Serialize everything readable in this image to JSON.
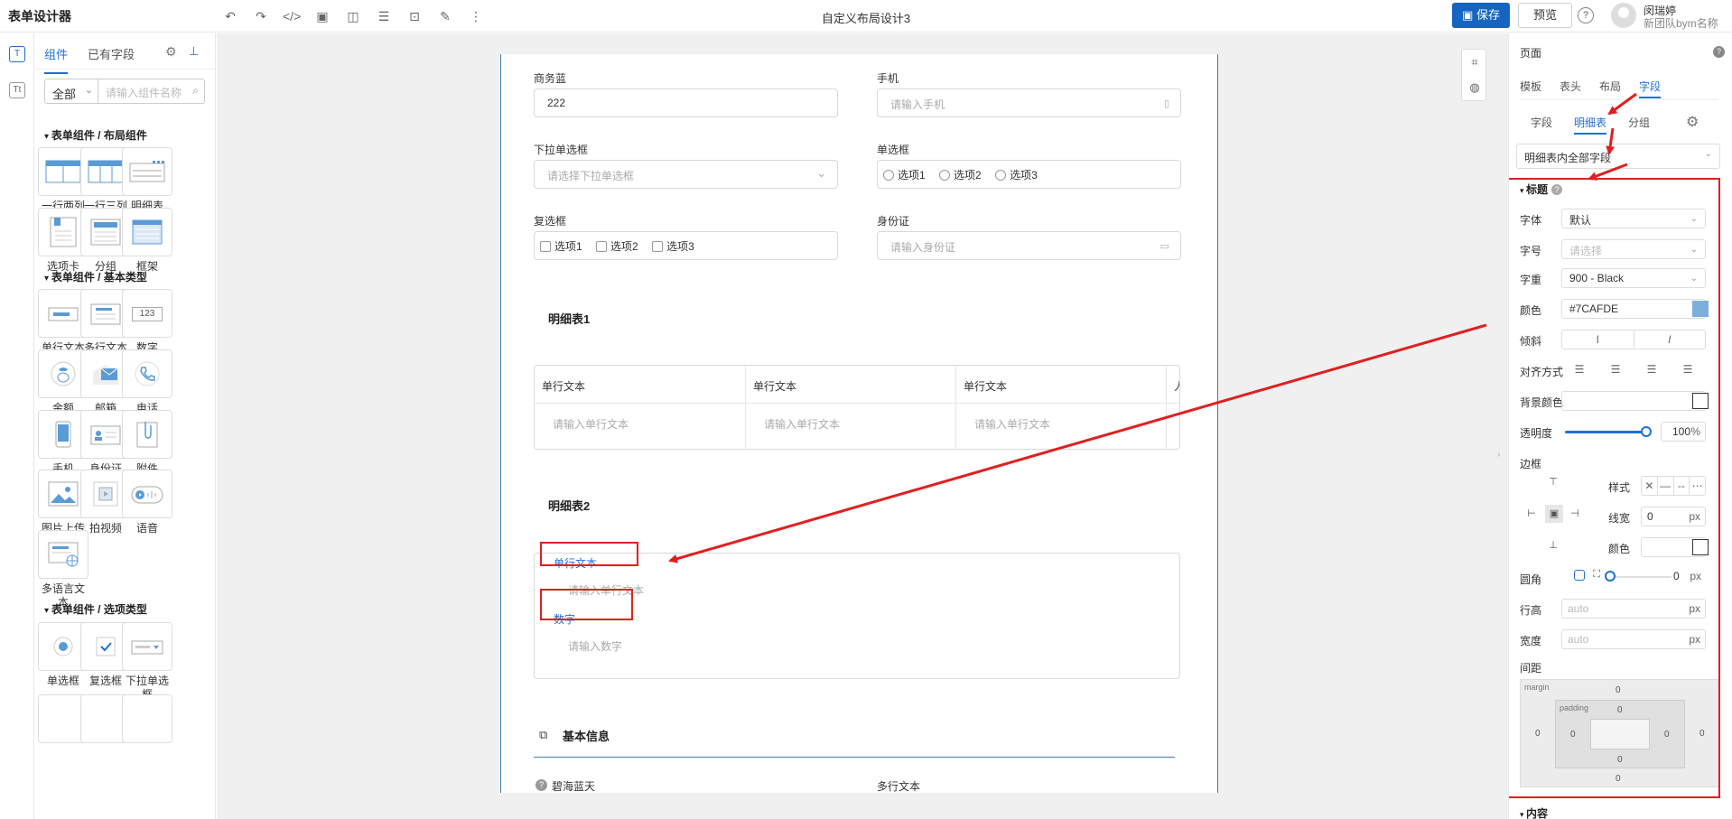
{
  "header": {
    "app_title": "表单设计器",
    "page_title": "自定义布局设计3",
    "save_label": "保存",
    "preview_label": "预览",
    "help_label": "?",
    "user_name": "闵瑞婷",
    "user_team": "新团队bym名称"
  },
  "component_panel": {
    "tabs": [
      "组件",
      "已有字段"
    ],
    "filter_value": "全部",
    "search_placeholder": "请输入组件名称",
    "sections": [
      {
        "title": "表单组件 / 布局组件",
        "items": [
          "一行两列",
          "一行三列",
          "明细表",
          "选项卡",
          "分组",
          "框架"
        ]
      },
      {
        "title": "表单组件 / 基本类型",
        "items": [
          "单行文本",
          "多行文本",
          "数字",
          "金额",
          "邮箱",
          "电话",
          "手机",
          "身份证",
          "附件",
          "图片上传",
          "拍视频",
          "语音",
          "多语言文本"
        ]
      },
      {
        "title": "表单组件 / 选项类型",
        "items": [
          "单选框",
          "复选框",
          "下拉单选框"
        ]
      }
    ],
    "number_icon_text": "123"
  },
  "form": {
    "fields": [
      {
        "label": "商务蓝",
        "value": "222",
        "placeholder": ""
      },
      {
        "label": "手机",
        "value": "",
        "placeholder": "请输入手机"
      },
      {
        "label": "下拉单选框",
        "value": "",
        "placeholder": "请选择下拉单选框"
      },
      {
        "label": "单选框",
        "options": [
          "选项1",
          "选项2",
          "选项3"
        ]
      },
      {
        "label": "复选框",
        "options": [
          "选项1",
          "选项2",
          "选项3"
        ]
      },
      {
        "label": "身份证",
        "value": "",
        "placeholder": "请输入身份证"
      }
    ],
    "detail_table_1": {
      "title": "明细表1",
      "columns": [
        "单行文本",
        "单行文本",
        "单行文本",
        "人"
      ],
      "cell_placeholder": "请输入单行文本"
    },
    "detail_table_2": {
      "title": "明细表2",
      "items": [
        {
          "label": "单行文本",
          "placeholder": "请输入单行文本"
        },
        {
          "label": "数字",
          "placeholder": "请输入数字"
        }
      ]
    },
    "group": {
      "title": "基本信息",
      "field_left": "碧海蓝天",
      "field_right": "多行文本"
    }
  },
  "properties": {
    "header": "页面",
    "help": "?",
    "tabs": [
      "模板",
      "表头",
      "布局",
      "字段"
    ],
    "active_tab": "字段",
    "subtabs": [
      "字段",
      "明细表",
      "分组"
    ],
    "active_subtab": "明细表",
    "scope_select": "明细表内全部字段",
    "title_section": "标题",
    "font_label": "字体",
    "font_value": "默认",
    "size_label": "字号",
    "size_placeholder": "请选择",
    "weight_label": "字重",
    "weight_value": "900 - Black",
    "color_label": "颜色",
    "color_value": "#7CAFDE",
    "italic_label": "倾斜",
    "align_label": "对齐方式",
    "bg_label": "背景颜色",
    "opacity_label": "透明度",
    "opacity_value": "100",
    "opacity_unit": "%",
    "opacity_level": 1.0,
    "border_label": "边框",
    "border_style_label": "样式",
    "border_width_label": "线宽",
    "border_width_value": "0",
    "border_color_label": "颜色",
    "radius_label": "圆角",
    "radius_value": "0",
    "line_height_label": "行高",
    "line_height_placeholder": "auto",
    "width_label": "宽度",
    "width_placeholder": "auto",
    "unit_px": "px",
    "spacing_label": "间距",
    "margin_label": "margin",
    "padding_label": "padding",
    "spacing_values": {
      "m_top": "0",
      "m_bottom": "0",
      "m_left": "0",
      "m_right": "0",
      "p_top": "0",
      "p_bottom": "0",
      "p_left": "0",
      "p_right": "0"
    },
    "content_section": "内容"
  },
  "colors": {
    "accent": "#1e6fd9",
    "save_button": "#1565c0",
    "annotation_red": "#e02020",
    "title_color_swatch": "#7CAFDE"
  }
}
